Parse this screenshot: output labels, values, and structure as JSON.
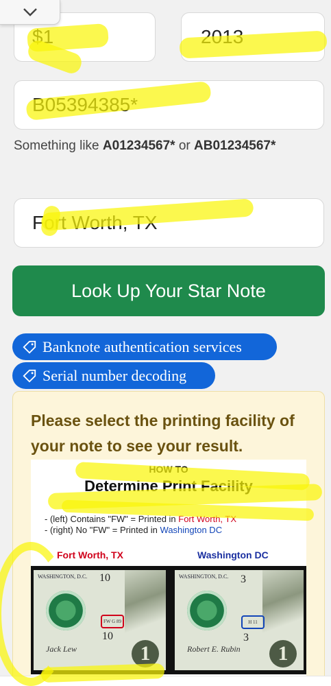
{
  "form": {
    "denomination": "$1",
    "series_year": "2013",
    "serial_number": "B05394385*",
    "hint_prefix": "Something like ",
    "hint_example_1": "A01234567*",
    "hint_or": " or ",
    "hint_example_2": "AB01234567*",
    "city": "Fort Worth, TX",
    "lookup_button": "Look Up Your Star Note"
  },
  "links": [
    {
      "label": "Banknote authentication services",
      "icon": "tag-icon"
    },
    {
      "label": "Serial number decoding",
      "icon": "tag-icon"
    }
  ],
  "result": {
    "message": "Please select the printing facility of your note to see your result."
  },
  "guide": {
    "howto": "HOW TO",
    "title": "Determine Print Facility",
    "line1_prefix": "- (left) Contains \"FW\" = Printed in ",
    "line1_place": "Fort Worth, TX",
    "line2_prefix": "- (right) No \"FW\" = Printed in ",
    "line2_place": "Washington DC",
    "label_left": "Fort Worth, TX",
    "label_right": "Washington DC",
    "note_left": {
      "city": "WASHINGTON, D.C.",
      "plate_top": "10",
      "plate_bottom": "10",
      "plate_code": "FW G 89",
      "denomination": "1",
      "signature": "Jack Lew"
    },
    "note_right": {
      "city": "WASHINGTON, D.C.",
      "plate_top": "3",
      "plate_bottom": "3",
      "plate_code": "H 11",
      "denomination": "1",
      "signature": "Robert E. Rubin"
    }
  },
  "colors": {
    "button_green": "#1f8a4c",
    "pill_blue": "#1266d9",
    "highlight_yellow": "#faf50a",
    "result_bg": "#fdf5da"
  }
}
